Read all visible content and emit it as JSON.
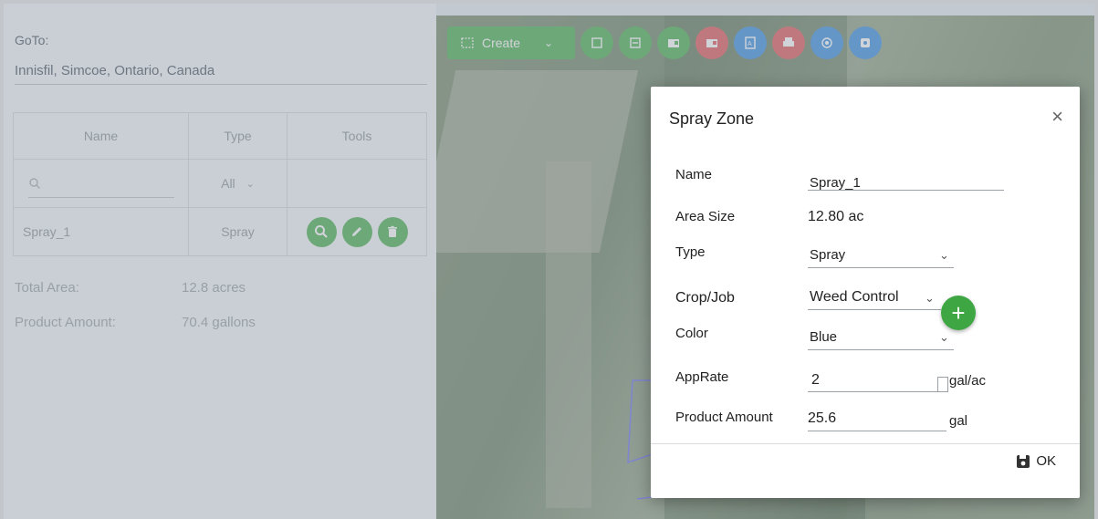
{
  "goto": {
    "label": "GoTo:",
    "value": "Innisfil, Simcoe, Ontario, Canada"
  },
  "table": {
    "headers": [
      "Name",
      "Type",
      "Tools"
    ],
    "filter": {
      "type_value": "All"
    },
    "rows": [
      {
        "name": "Spray_1",
        "type": "Spray"
      }
    ]
  },
  "summary": {
    "total_area_label": "Total Area:",
    "total_area_value": "12.8 acres",
    "product_amount_label": "Product Amount:",
    "product_amount_value": "70.4 gallons"
  },
  "toolbar": {
    "create_label": "Create",
    "colors": {
      "green": "#4caf50",
      "red": "#e05a5a",
      "blue": "#3d8fe0"
    }
  },
  "dialog": {
    "title": "Spray Zone",
    "close": "×",
    "fields": {
      "name_label": "Name",
      "name_value": "Spray_1",
      "area_label": "Area Size",
      "area_value": "12.80 ac",
      "type_label": "Type",
      "type_value": "Spray",
      "crop_label": "Crop/Job",
      "crop_value": "Weed Control",
      "color_label": "Color",
      "color_value": "Blue",
      "apprate_label": "AppRate",
      "apprate_value": "2",
      "apprate_unit": "gal/ac",
      "product_label": "Product Amount",
      "product_value": "25.6",
      "product_unit": "gal"
    },
    "ok_label": "OK"
  }
}
